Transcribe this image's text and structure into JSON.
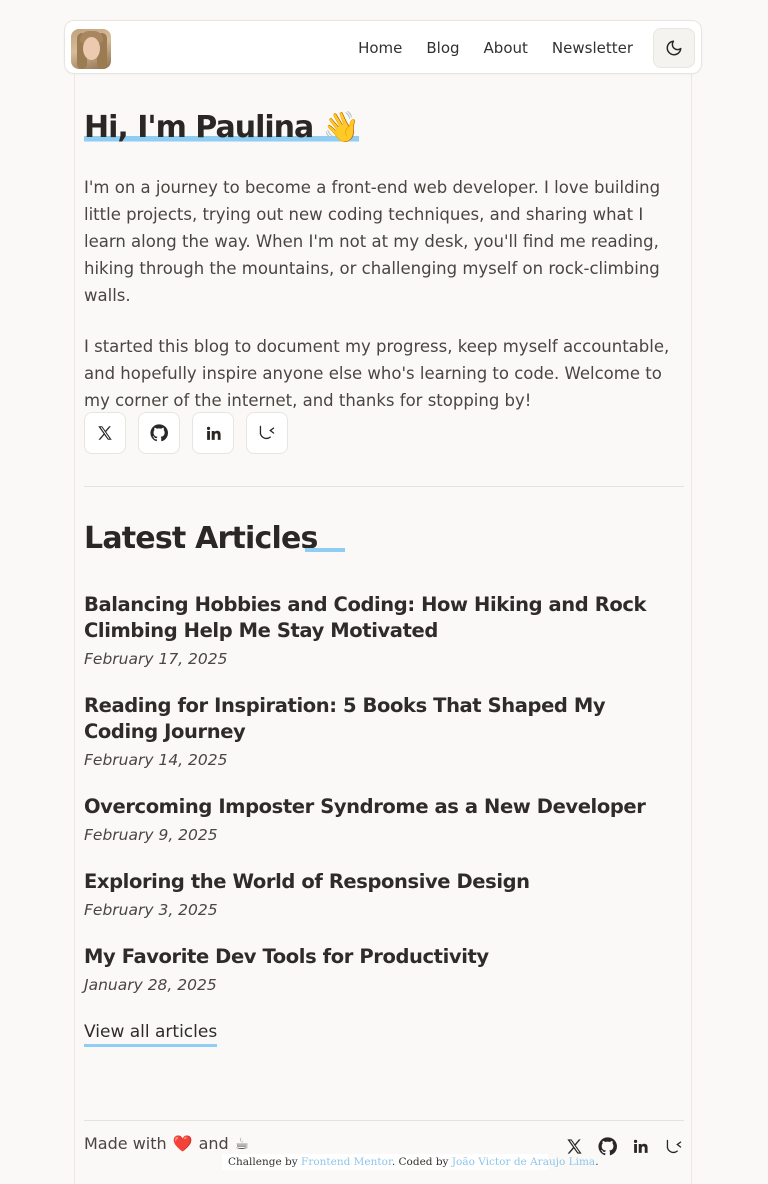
{
  "header": {
    "avatar_alt": "Paulina avatar",
    "nav": [
      {
        "label": "Home"
      },
      {
        "label": "Blog"
      },
      {
        "label": "About"
      },
      {
        "label": "Newsletter"
      }
    ],
    "theme_toggle_icon": "moon-icon"
  },
  "hero": {
    "title_prefix": "Hi, I'm Paulina",
    "title_emoji": "👋",
    "paragraphs": [
      "I'm on a journey to become a front-end web developer. I love building little projects, trying out new coding techniques, and sharing what I learn along the way. When I'm not at my desk, you'll find me reading, hiking through the mountains, or challenging myself on rock-climbing walls.",
      "I started this blog to document my progress, keep myself accountable, and hopefully inspire anyone else who's learning to code. Welcome to my corner of the internet, and thanks for stopping by!"
    ],
    "socials": [
      "x-icon",
      "github-icon",
      "linkedin-icon",
      "frontend-mentor-icon"
    ]
  },
  "latest": {
    "title": "Latest Articles",
    "articles": [
      {
        "title": "Balancing Hobbies and Coding: How Hiking and Rock Climbing Help Me Stay Motivated",
        "date": "February 17, 2025"
      },
      {
        "title": "Reading for Inspiration: 5 Books That Shaped My Coding Journey",
        "date": "February 14, 2025"
      },
      {
        "title": "Overcoming Imposter Syndrome as a New Developer",
        "date": "February 9, 2025"
      },
      {
        "title": "Exploring the World of Responsive Design",
        "date": "February 3, 2025"
      },
      {
        "title": "My Favorite Dev Tools for Productivity",
        "date": "January 28, 2025"
      }
    ],
    "view_all": "View all articles"
  },
  "footer": {
    "made_with": "Made with",
    "heart": "❤️",
    "and": "and",
    "coffee": "☕",
    "attribution_prefix": "Challenge by",
    "attribution_link1": "Frontend Mentor",
    "attribution_middle": ". Coded by",
    "attribution_link2": "João Victor de Araujo Lima",
    "attribution_suffix": ".",
    "socials": [
      "x-icon",
      "github-icon",
      "linkedin-icon",
      "frontend-mentor-icon"
    ]
  },
  "colors": {
    "accent": "#90cdf4",
    "background": "#faf9f7",
    "text": "#34302d"
  }
}
